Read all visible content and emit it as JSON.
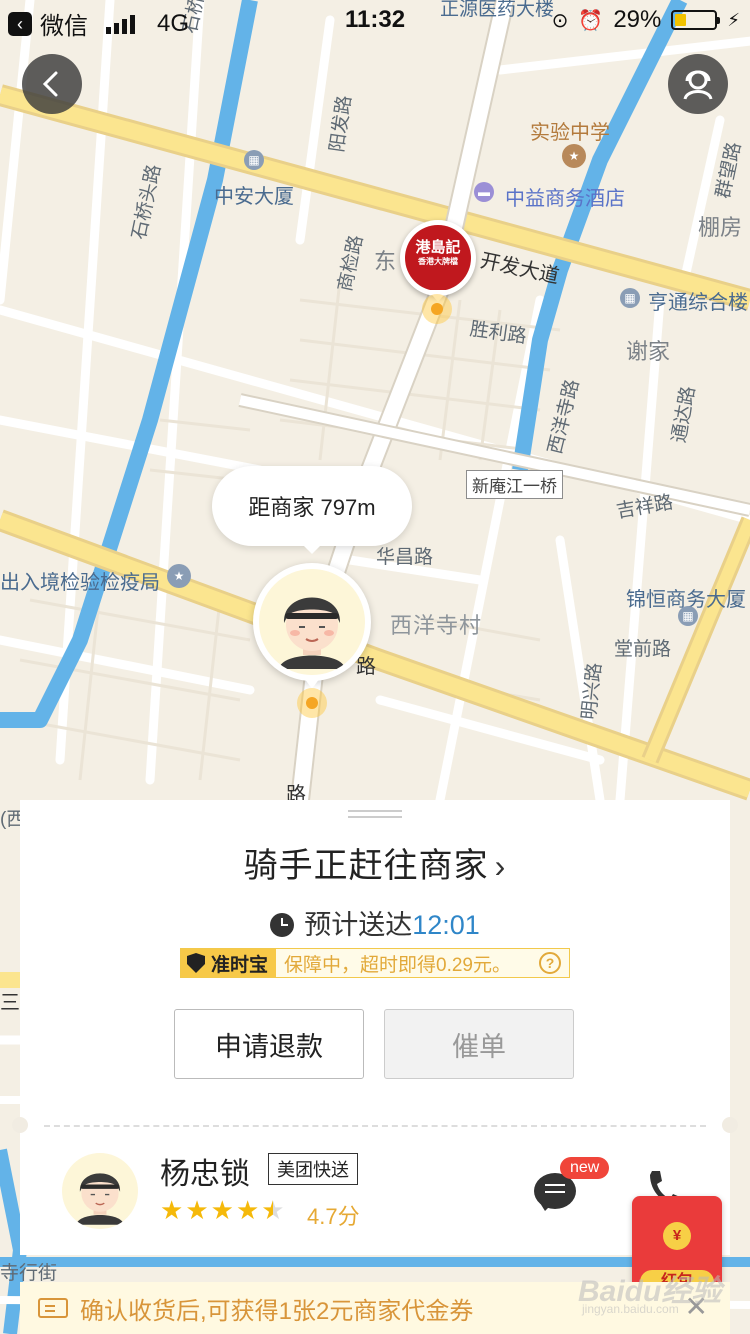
{
  "status_bar": {
    "back_app": "微信",
    "network": "4G",
    "time": "11:32",
    "battery": "29%",
    "battery_level": 0.29
  },
  "map": {
    "labels": {
      "zhengyuan": "正源医药大楼",
      "shiqiao_top": "石桥头",
      "yangfa": "阳发路",
      "shiyan": "实验中学",
      "zhongan": "中安大厦",
      "zhongyi": "中益商务酒店",
      "qunwang": "群望路",
      "pengfang": "棚房",
      "shiqiao_road": "石桥头路",
      "shangjian": "商检路",
      "dong": "东",
      "kaifa": "开发大道",
      "tongtong": "亨通综合楼",
      "shengli": "胜利路",
      "xiejia": "谢家",
      "xiyangsi": "西洋寺路",
      "tongda": "通达路",
      "bridge": "新庵江一桥",
      "jixiang": "吉祥路",
      "huachang": "华昌路",
      "crj": "出入境检验检疫局",
      "xiyangcun": "西洋寺村",
      "jinheng": "锦恒商务大厦",
      "tangqian": "堂前路",
      "mingxing": "明兴路",
      "lu1": "路",
      "lu2": "路",
      "xi": "(西",
      "san": "三",
      "xingjie": "寺行街"
    },
    "merchant_logo_text": "港島記",
    "merchant_logo_sub": "香港大牌檔"
  },
  "distance_bubble": "距商家 797m",
  "order": {
    "status_title": "骑手正赶往商家",
    "eta_label": "预计送达",
    "eta_time": "12:01",
    "guarantee_badge": "准时宝",
    "guarantee_text": "保障中，超时即得0.29元。",
    "refund_label": "申请退款",
    "urge_label": "催单"
  },
  "rider": {
    "name": "杨忠锁",
    "tag": "美团快送",
    "rating_text": "4.7分",
    "rating_value": 4.7,
    "new_badge": "new"
  },
  "red_packet": {
    "coin": "¥",
    "label": "红包"
  },
  "coupon": {
    "text": "确认收货后,可获得1张2元商家代金券"
  },
  "watermark": {
    "text": "Baidu经验",
    "sub": "jingyan.baidu.com"
  },
  "colors": {
    "accent_blue": "#2f86c8",
    "guarantee_yellow": "#f7c948",
    "coupon_orange": "#d8953a",
    "red_packet": "#ea3b3b",
    "river": "#5fb0e6",
    "main_road": "#fbe58f"
  }
}
